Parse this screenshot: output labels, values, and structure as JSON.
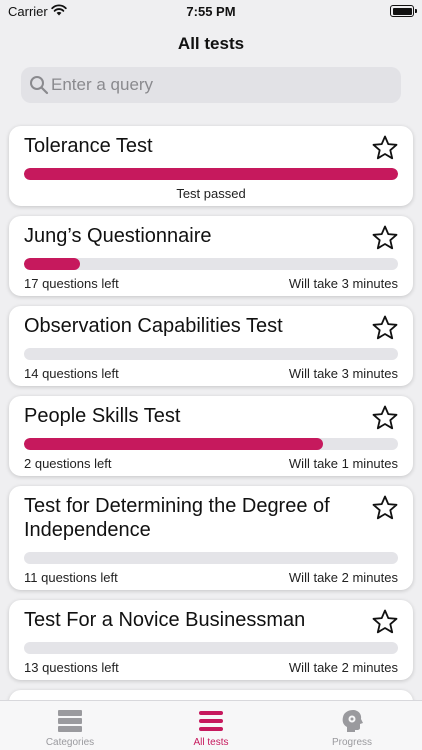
{
  "status_bar": {
    "carrier": "Carrier",
    "time": "7:55 PM"
  },
  "header": {
    "title": "All tests"
  },
  "search": {
    "placeholder": "Enter a query",
    "value": ""
  },
  "tests": [
    {
      "title": "Tolerance Test",
      "progress": 1.0,
      "status": "Test passed",
      "questions_left": "",
      "duration": ""
    },
    {
      "title": "Jung’s Questionnaire",
      "progress": 0.15,
      "status": "",
      "questions_left": "17 questions left",
      "duration": "Will take 3 minutes"
    },
    {
      "title": "Observation Capabilities Test",
      "progress": 0.0,
      "status": "",
      "questions_left": "14 questions left",
      "duration": "Will take 3 minutes"
    },
    {
      "title": "People Skills Test",
      "progress": 0.8,
      "status": "",
      "questions_left": "2 questions left",
      "duration": "Will take 1 minutes"
    },
    {
      "title": "Test for Determining the Degree of Independence",
      "progress": 0.0,
      "status": "",
      "questions_left": "11 questions left",
      "duration": "Will take 2 minutes"
    },
    {
      "title": "Test For a Novice Businessman",
      "progress": 0.0,
      "status": "",
      "questions_left": "13 questions left",
      "duration": "Will take 2 minutes"
    }
  ],
  "tab_bar": {
    "tabs": [
      {
        "label": "Categories",
        "icon": "categories-icon"
      },
      {
        "label": "All tests",
        "icon": "list-icon"
      },
      {
        "label": "Progress",
        "icon": "head-gear-icon"
      }
    ],
    "active": "All tests"
  },
  "colors": {
    "accent": "#c6195d",
    "track": "#e4e4e8",
    "background": "#efeff1"
  }
}
